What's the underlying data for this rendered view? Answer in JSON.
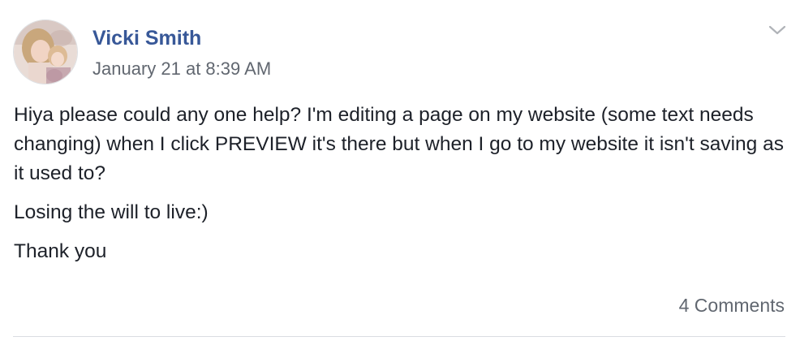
{
  "post": {
    "author": "Vicki Smith",
    "timestamp": "January 21 at 8:39 AM",
    "paragraphs": [
      "Hiya please could any one help? I'm editing a page on my website (some text needs changing) when I click PREVIEW it's there but when I go to my website it isn't saving as it used to?",
      "Losing the will to live:)",
      "Thank you"
    ],
    "comments_label": "4 Comments",
    "menu_icon": "chevron-down-icon",
    "avatar_icon": "profile-photo"
  },
  "colors": {
    "author_link": "#385898",
    "secondary_text": "#616770",
    "body_text": "#1d2129",
    "divider": "#dadde1"
  }
}
